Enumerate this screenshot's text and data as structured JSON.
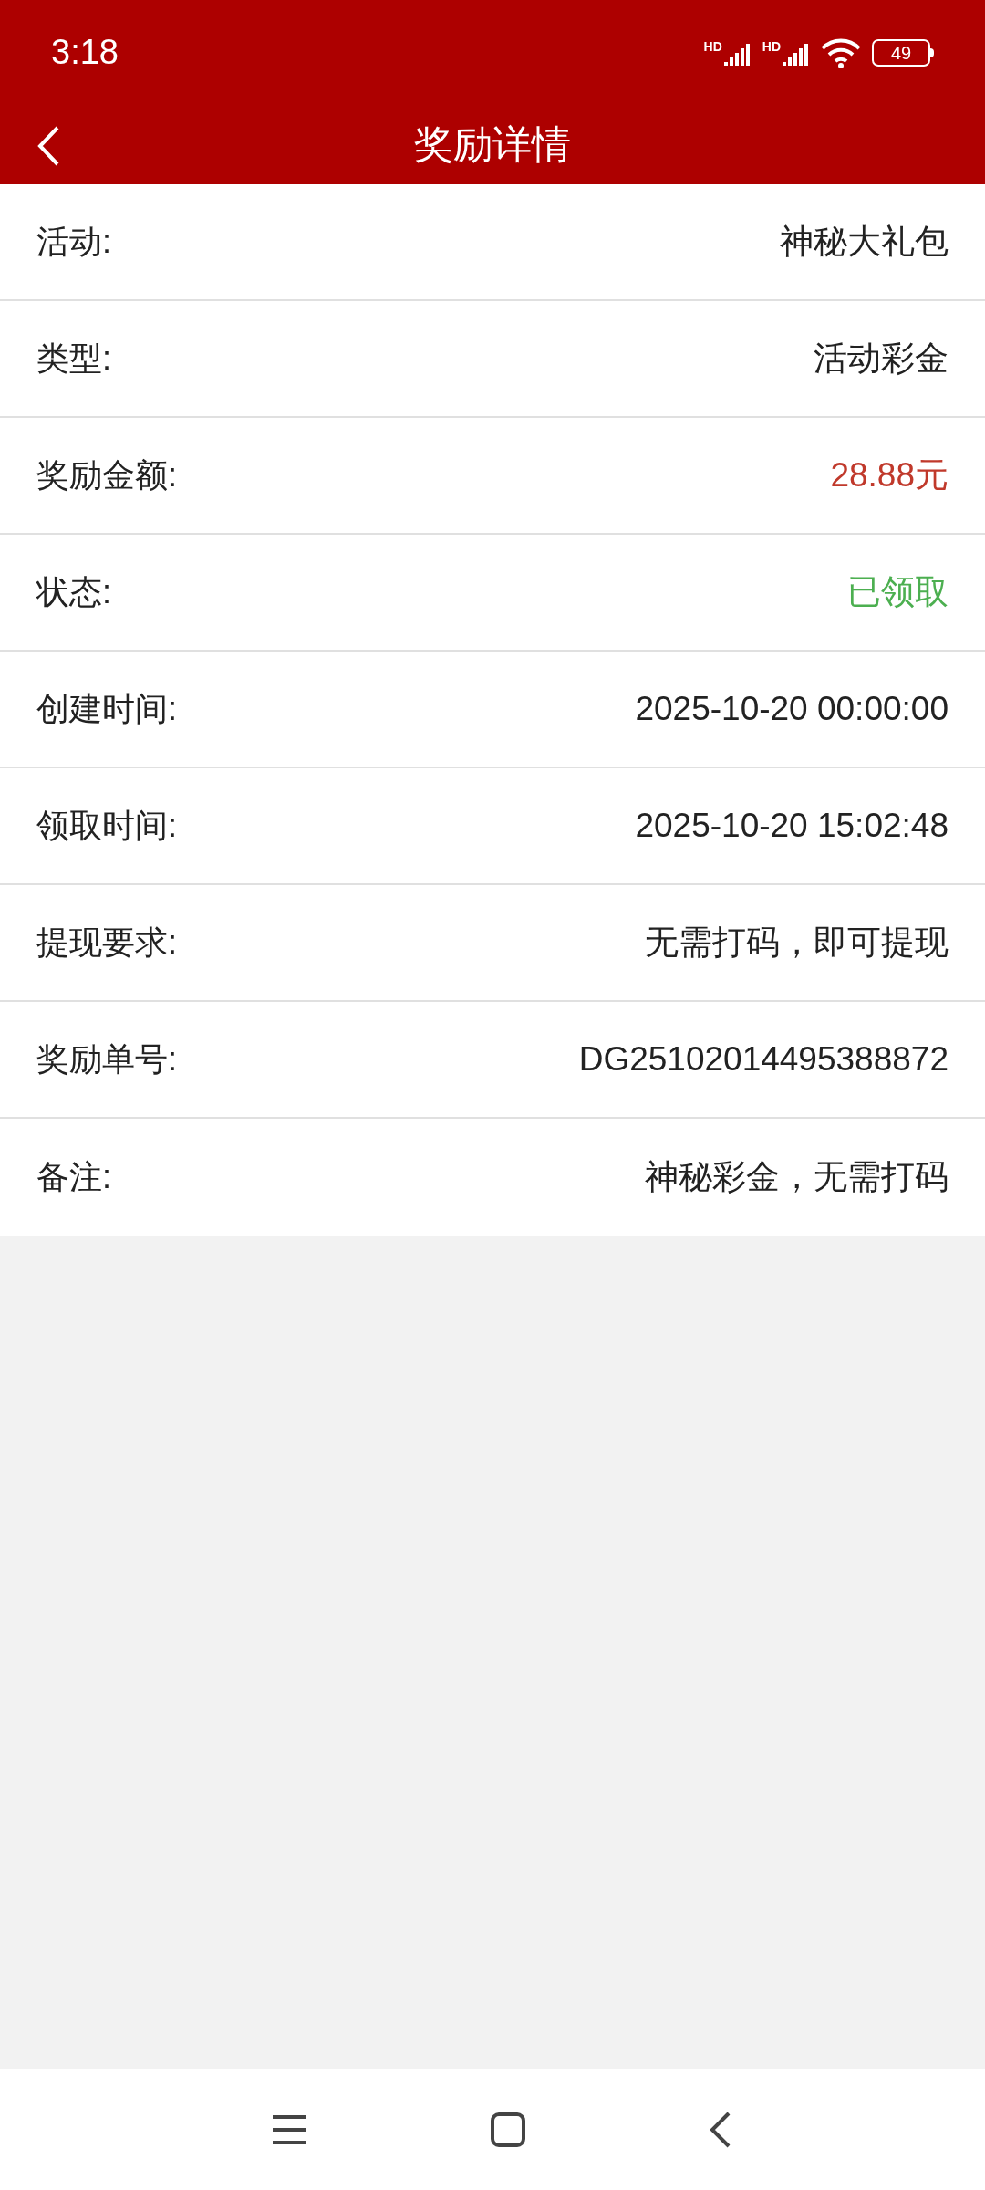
{
  "status_bar": {
    "time": "3:18",
    "signal_labels": [
      "HD",
      "HD"
    ],
    "battery": "49"
  },
  "header": {
    "title": "奖励详情"
  },
  "rows": [
    {
      "label": "活动:",
      "value": "神秘大礼包",
      "kind": "plain"
    },
    {
      "label": "类型:",
      "value": "活动彩金",
      "kind": "plain"
    },
    {
      "label": "奖励金额:",
      "value": "28.88元",
      "kind": "amount"
    },
    {
      "label": "状态:",
      "value": "已领取",
      "kind": "status"
    },
    {
      "label": "创建时间:",
      "value": "2025-10-20 00:00:00",
      "kind": "plain"
    },
    {
      "label": "领取时间:",
      "value": "2025-10-20 15:02:48",
      "kind": "plain"
    },
    {
      "label": "提现要求:",
      "value": "无需打码，即可提现",
      "kind": "plain"
    },
    {
      "label": "奖励单号:",
      "value": "DG25102014495388872",
      "kind": "plain"
    },
    {
      "label": "备注:",
      "value": "神秘彩金，无需打码",
      "kind": "plain"
    }
  ]
}
